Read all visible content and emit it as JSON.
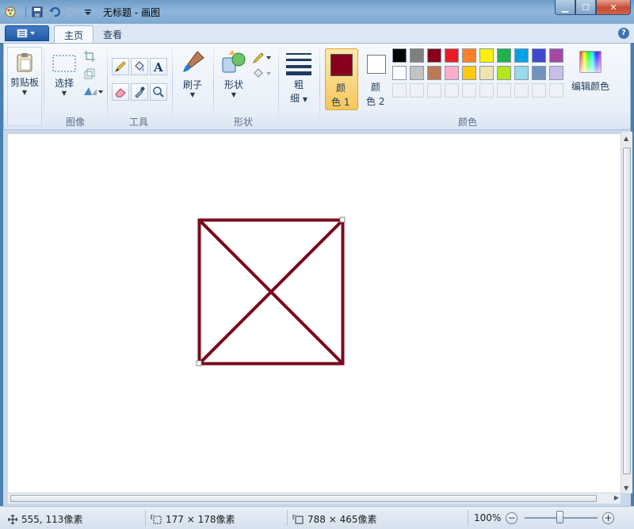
{
  "window": {
    "title": "无标题 - 画图",
    "min": "▁",
    "max": "☐",
    "close": "✕"
  },
  "tabs": [
    {
      "label": "主页",
      "active": true
    },
    {
      "label": "查看",
      "active": false
    }
  ],
  "help_label": "?",
  "ribbon": {
    "clipboard": {
      "label": "剪贴板"
    },
    "select": {
      "label": "选择"
    },
    "image_group": "图像",
    "tools_group": "工具",
    "brush": {
      "label": "刷子"
    },
    "shapes": {
      "label": "形状"
    },
    "shapes_group": "形状",
    "size": {
      "label_1": "粗",
      "label_2": "细"
    },
    "color1": {
      "label_1": "颜",
      "label_2": "色 1",
      "value": "#88001b"
    },
    "color2": {
      "label_1": "颜",
      "label_2": "色 2",
      "value": "#ffffff"
    },
    "colors_group": "颜色",
    "edit_colors": {
      "label": "编辑颜色"
    },
    "palette_row1": [
      "#000000",
      "#7f7f7f",
      "#880015",
      "#ed1c24",
      "#ff7f27",
      "#fff200",
      "#22b14c",
      "#00a2e8",
      "#3f48cc",
      "#a349a4"
    ],
    "palette_row2": [
      "#ffffff",
      "#c3c3c3",
      "#b97a57",
      "#ffaec9",
      "#ffc90e",
      "#efe4b0",
      "#b5e61d",
      "#99d9ea",
      "#7092be",
      "#c8bfe7"
    ]
  },
  "drawing": {
    "stroke_color": "#7a0a1e"
  },
  "status": {
    "cursor_pos": "555, 113像素",
    "selection_size": "177 × 178像素",
    "image_size": "788 × 465像素",
    "zoom": "100%",
    "zoom_out": "−",
    "zoom_in": "+"
  }
}
